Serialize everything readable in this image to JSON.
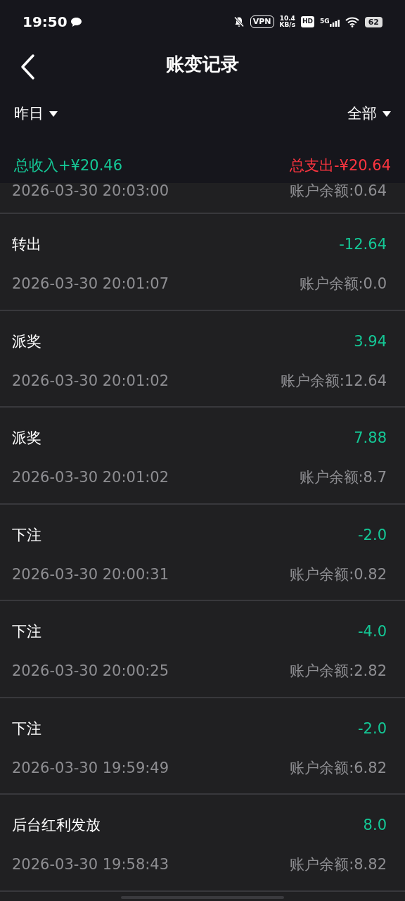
{
  "status_bar": {
    "time": "19:50",
    "vpn": "VPN",
    "speed_value": "10.4",
    "speed_unit": "KB/s",
    "hd": "HD",
    "network": "5G",
    "battery": "62"
  },
  "header": {
    "title": "账变记录"
  },
  "filters": [
    {
      "label": "昨日"
    },
    {
      "label": "全部"
    }
  ],
  "totals": {
    "income": "总收入+¥20.46",
    "expense": "总支出-¥20.64"
  },
  "records": [
    {
      "time": "2026-03-30 20:03:00",
      "balance": "账户余额:0.64"
    },
    {
      "type": "转出",
      "amount": "-12.64",
      "time": "2026-03-30 20:01:07",
      "balance": "账户余额:0.0"
    },
    {
      "type": "派奖",
      "amount": "3.94",
      "time": "2026-03-30 20:01:02",
      "balance": "账户余额:12.64"
    },
    {
      "type": "派奖",
      "amount": "7.88",
      "time": "2026-03-30 20:01:02",
      "balance": "账户余额:8.7"
    },
    {
      "type": "下注",
      "amount": "-2.0",
      "time": "2026-03-30 20:00:31",
      "balance": "账户余额:0.82"
    },
    {
      "type": "下注",
      "amount": "-4.0",
      "time": "2026-03-30 20:00:25",
      "balance": "账户余额:2.82"
    },
    {
      "type": "下注",
      "amount": "-2.0",
      "time": "2026-03-30 19:59:49",
      "balance": "账户余额:6.82"
    },
    {
      "type": "后台红利发放",
      "amount": "8.0",
      "time": "2026-03-30 19:58:43",
      "balance": "账户余额:8.82"
    }
  ]
}
